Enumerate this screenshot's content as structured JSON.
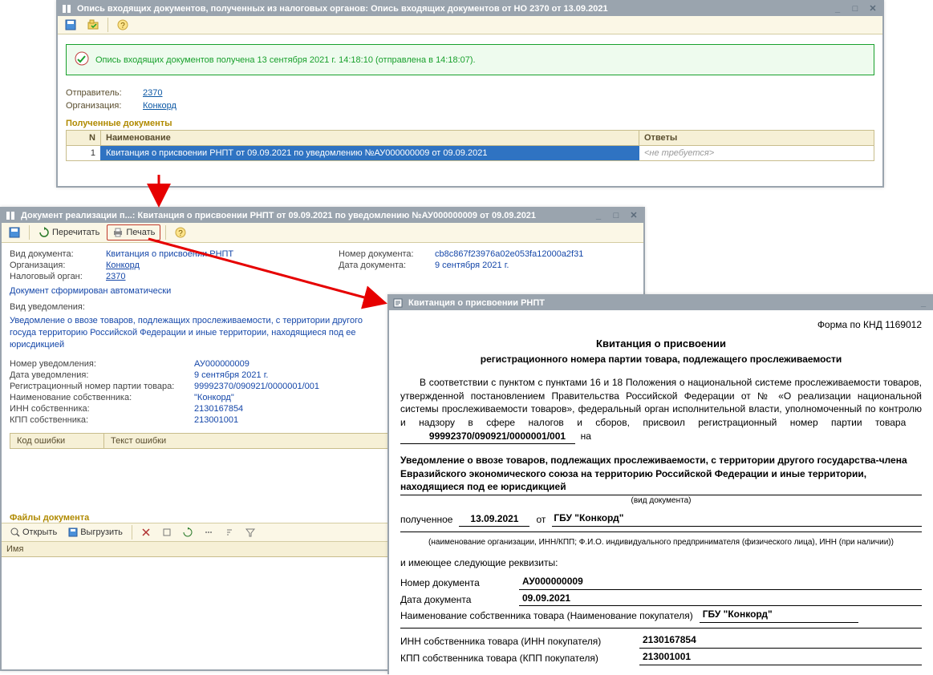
{
  "win1": {
    "title": "Опись входящих документов, полученных из налоговых органов: Опись входящих документов от НО 2370 от 13.09.2021",
    "status": "Опись входящих документов получена 13 сентября 2021 г. 14:18:10 (отправлена в 14:18:07).",
    "sender_label": "Отправитель:",
    "sender_value": "2370",
    "org_label": "Организация:",
    "org_value": "Конкорд",
    "received_header": "Полученные документы",
    "cols": {
      "n": "N",
      "name": "Наименование",
      "ans": "Ответы"
    },
    "row": {
      "n": "1",
      "name": "Квитанция о присвоении РНПТ от 09.09.2021 по уведомлению №АУ000000009 от 09.09.2021",
      "ans": "<не требуется>"
    }
  },
  "win2": {
    "title": "Документ реализации п...: Квитанция о присвоении РНПТ от 09.09.2021 по уведомлению №АУ000000009 от 09.09.2021",
    "reread": "Перечитать",
    "print": "Печать",
    "left": {
      "doc_type_l": "Вид документа:",
      "doc_type_v": "Квитанция о присвоении РНПТ",
      "org_l": "Организация:",
      "org_v": "Конкорд",
      "tax_l": "Налоговый орган:",
      "tax_v": "2370"
    },
    "right": {
      "num_l": "Номер документа:",
      "num_v": "cb8c867f23976a02e053fa12000a2f31",
      "date_l": "Дата документа:",
      "date_v": "9 сентября 2021 г."
    },
    "autogen": "Документ сформирован автоматически",
    "notice_type_l": "Вид уведомления:",
    "notice_desc": "Уведомление о ввозе товаров, подлежащих прослеживаемости, с территории другого госуда территорию Российской Федерации и иные территории, находящиеся под ее юрисдикцией",
    "fields": {
      "notice_num_l": "Номер уведомления:",
      "notice_num_v": "АУ000000009",
      "notice_date_l": "Дата уведомления:",
      "notice_date_v": "9 сентября 2021 г.",
      "reg_num_l": "Регистрационный номер партии товара:",
      "reg_num_v": "99992370/090921/0000001/001",
      "owner_name_l": "Наименование собственника:",
      "owner_name_v": "\"Конкорд\"",
      "owner_inn_l": "ИНН собственника:",
      "owner_inn_v": "2130167854",
      "owner_kpp_l": "КПП собственника:",
      "owner_kpp_v": "213001001"
    },
    "err_code": "Код ошибки",
    "err_text": "Текст ошибки",
    "files_header": "Файлы документа",
    "open": "Открыть",
    "export": "Выгрузить",
    "files_col": "Имя"
  },
  "win3": {
    "title": "Квитанция о присвоении РНПТ",
    "form_no": "Форма по КНД 1169012",
    "h1": "Квитанция о присвоении",
    "h2": "регистрационного номера партии товара, подлежащего прослеживаемости",
    "para1a": "В соответствии с пунктом с пунктами 16 и 18 Положения о национальной системе прослеживаемости товаров, утвержденной постановлением Правительства Российской Федерации от № «О реализации национальной системы прослеживаемости товаров», федеральный орган исполнительной власти, уполномоченный по контролю и надзору в сфере налогов и сборов, присвоил регистрационный номер партии товара",
    "reg_num": "99992370/090921/0000001/001",
    "na_suffix": "на",
    "doc_kind": "Уведомление о ввозе товаров, подлежащих прослеживаемости, с территории другого государства-члена Евразийского экономического союза на территорию Российской Федерации и иные территории, находящиеся под ее юрисдикцией",
    "doc_kind_caption": "(вид документа)",
    "received_l": "полученное",
    "received_date": "13.09.2021",
    "from": "от",
    "org": "ГБУ \"Конкорд\"",
    "org_caption": "(наименование организации, ИНН/КПП; Ф.И.О. индивидуального предпринимателя (физического лица), ИНН (при наличии))",
    "has_req": "и имеющее следующие реквизиты:",
    "doc_num_l": "Номер документа",
    "doc_num_v": "АУ000000009",
    "doc_date_l": "Дата документа",
    "doc_date_v": "09.09.2021",
    "owner_l": "Наименование собственника товара (Наименование покупателя)",
    "owner_v": "ГБУ \"Конкорд\"",
    "inn_l": "ИНН собственника товара (ИНН покупателя)",
    "inn_v": "2130167854",
    "kpp_l": "КПП собственника товара (КПП покупателя)",
    "kpp_v": "213001001"
  }
}
